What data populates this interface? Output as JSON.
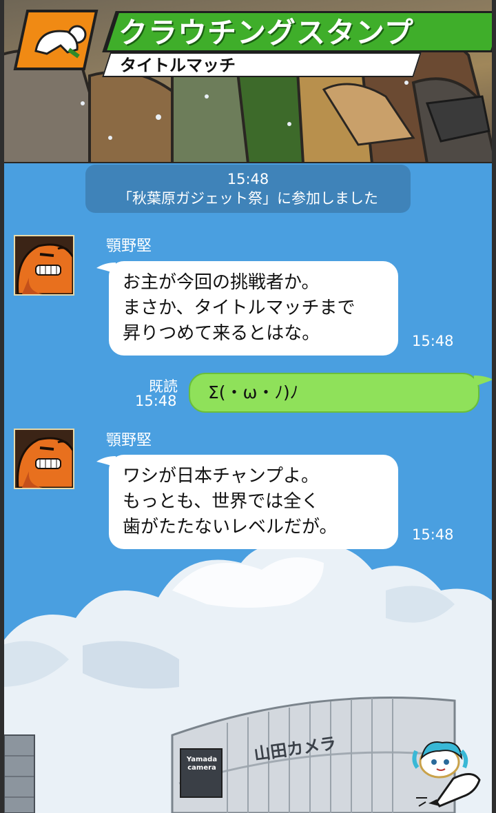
{
  "header": {
    "title": "クラウチングスタンプ",
    "subtitle": "タイトルマッチ",
    "icon": "crouching-figure-icon"
  },
  "chat": {
    "system_message": {
      "time": "15:48",
      "text": "「秋葉原ガジェット祭」に参加しました"
    },
    "messages": [
      {
        "sender": "顎野堅",
        "avatar": "orange-brute-avatar",
        "lines": [
          "お主が今回の挑戦者か。",
          "まさか、タイトルマッチまで",
          "昇りつめて来るとはな。"
        ],
        "time": "15:48"
      },
      {
        "sender": "me",
        "text": "Σ(・ω・ﾉ)ﾉ",
        "read_label": "既読",
        "time": "15:48"
      },
      {
        "sender": "顎野堅",
        "avatar": "orange-brute-avatar",
        "lines": [
          "ワシが日本チャンプよ。",
          "もっとも、世界では全く",
          "歯がたたないレベルだが。"
        ],
        "time": "15:48"
      }
    ]
  },
  "background": {
    "building_sign": "山田カメラ",
    "camera_logo_line1": "Yamada",
    "camera_logo_line2": "camera"
  },
  "fab": {
    "icon": "character-pen-icon"
  },
  "colors": {
    "chat_bg": "#4a9fe0",
    "system_bubble": "#3f83b9",
    "incoming_bubble": "#ffffff",
    "outgoing_bubble": "#8fe15a",
    "title_green": "#3fae2a",
    "title_icon_orange": "#f08a14"
  }
}
